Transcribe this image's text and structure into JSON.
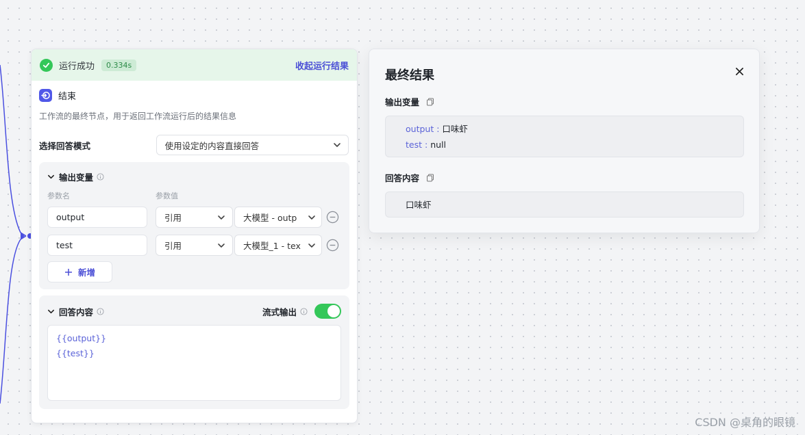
{
  "run": {
    "status": "运行成功",
    "time": "0.334s",
    "collapse": "收起运行结果"
  },
  "node": {
    "title": "结束",
    "description": "工作流的最终节点，用于返回工作流运行后的结果信息"
  },
  "mode": {
    "label": "选择回答模式",
    "value": "使用设定的内容直接回答"
  },
  "output_section": {
    "title": "输出变量",
    "col_name": "参数名",
    "col_value": "参数值",
    "rows": [
      {
        "name": "output",
        "ref": "引用",
        "source": "大模型 - outp"
      },
      {
        "name": "test",
        "ref": "引用",
        "source": "大模型_1 - tex"
      }
    ],
    "add": "新增"
  },
  "answer_section": {
    "title": "回答内容",
    "stream_label": "流式输出",
    "stream_on": true,
    "lines": [
      "{{output}}",
      "{{test}}"
    ]
  },
  "panel": {
    "title": "最终结果",
    "output_label": "输出变量",
    "outputs": [
      {
        "key": "output",
        "sep": " : ",
        "value": "口味虾"
      },
      {
        "key": "test",
        "sep": " : ",
        "value": "null"
      }
    ],
    "answer_label": "回答内容",
    "answer": "口味虾"
  },
  "watermark": "CSDN @桌角的眼镜",
  "colors": {
    "accent": "#4b4fd6",
    "success": "#34c759",
    "edge": "#4a4fe0"
  }
}
